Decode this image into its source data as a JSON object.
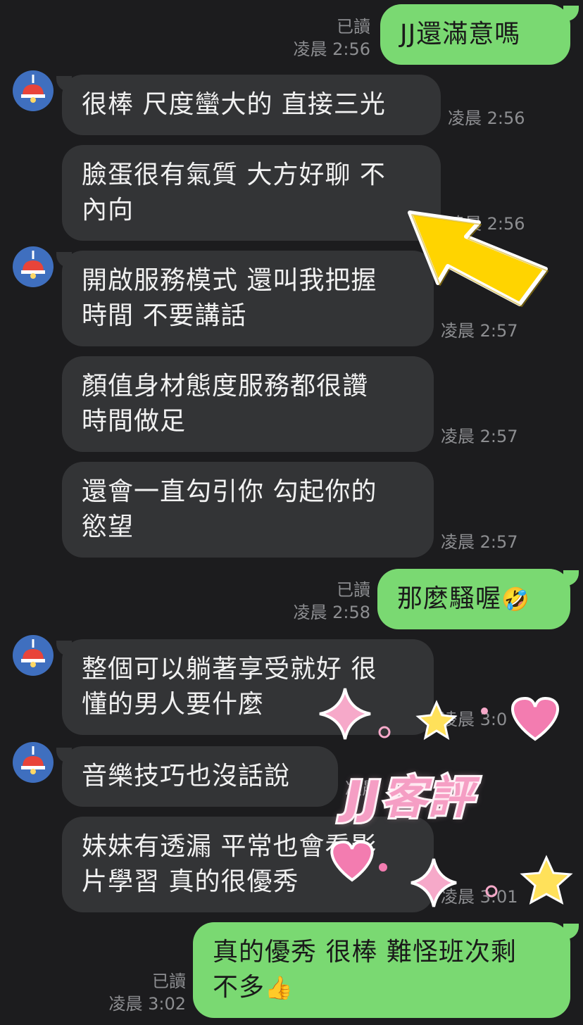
{
  "messages": [
    {
      "side": "out",
      "text": "JJ還滿意嗎",
      "read": "已讀",
      "time": "凌晨 2:56"
    },
    {
      "side": "in",
      "lines": [
        "很棒 尺度蠻大的 直接三光"
      ],
      "time": "凌晨 2:56"
    },
    {
      "side": "in",
      "lines": [
        "臉蛋很有氣質 大方好聊 不",
        "內向"
      ],
      "time": "凌晨 2:56"
    },
    {
      "side": "in",
      "lines": [
        "開啟服務模式 還叫我把握",
        "時間 不要講話"
      ],
      "time": "凌晨 2:57"
    },
    {
      "side": "in",
      "lines": [
        "顏值身材態度服務都很讚",
        "時間做足"
      ],
      "time": "凌晨 2:57"
    },
    {
      "side": "in",
      "lines": [
        "還會一直勾引你 勾起你的",
        "慾望"
      ],
      "time": "凌晨 2:57"
    },
    {
      "side": "out",
      "text": "那麼騷喔",
      "emoji": "🤣",
      "read": "已讀",
      "time": "凌晨 2:58"
    },
    {
      "side": "in",
      "lines": [
        "整個可以躺著享受就好 很",
        "懂的男人要什麼"
      ],
      "time": "凌晨 3:0"
    },
    {
      "side": "in",
      "lines": [
        "音樂技巧也沒話說"
      ],
      "time": "凌晨"
    },
    {
      "side": "in",
      "lines": [
        "妹妹有透漏 平常也會看影",
        "片學習 真的很優秀"
      ],
      "time": "凌晨 3:01"
    },
    {
      "side": "out",
      "lines": [
        "真的優秀 很棒 難怪班次剩",
        "不多"
      ],
      "emoji": "👍",
      "read": "已讀",
      "time": "凌晨 3:02"
    }
  ],
  "sticker": {
    "text": "JJ客評"
  },
  "colors": {
    "background": "#1c1c1e",
    "incoming": "#333436",
    "outgoing": "#7ad972",
    "arrow": "#ffd400"
  }
}
